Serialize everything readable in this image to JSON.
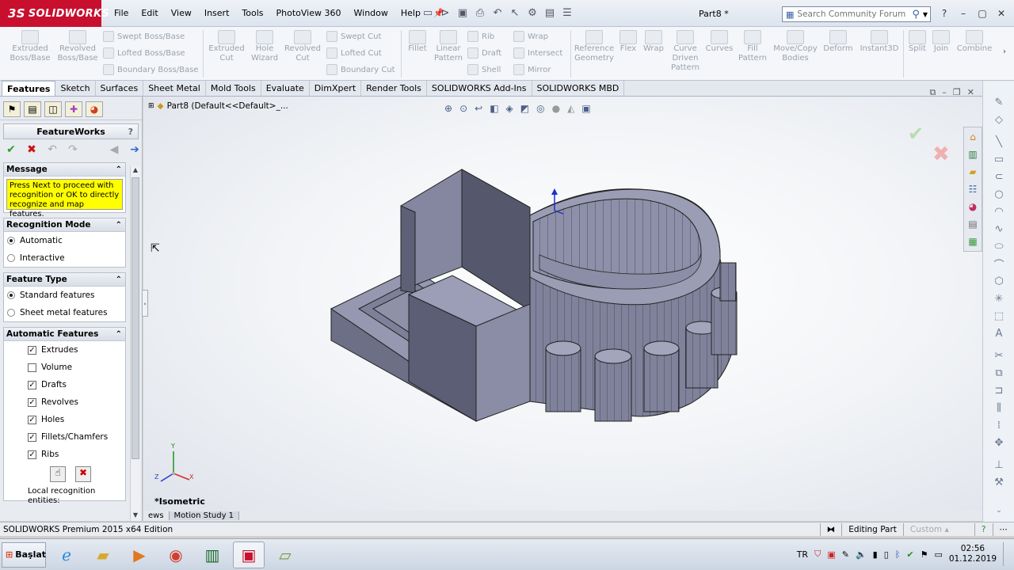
{
  "app": {
    "logo_text": "SOLIDWORKS",
    "logo_prefix": "3S",
    "document_title": "Part8 *",
    "colors": {
      "brand_red": "#c8102e",
      "message_yellow": "#ffff00",
      "ok_green": "#2ea02e",
      "cancel_red": "#cc1111"
    }
  },
  "menu": [
    "File",
    "Edit",
    "View",
    "Insert",
    "Tools",
    "PhotoView 360",
    "Window",
    "Help"
  ],
  "search": {
    "placeholder": "Search Community Forum"
  },
  "ribbon": {
    "extruded_boss": "Extruded Boss/Base",
    "revolved_boss": "Revolved Boss/Base",
    "swept_boss": "Swept Boss/Base",
    "lofted_boss": "Lofted Boss/Base",
    "boundary_boss": "Boundary Boss/Base",
    "extruded_cut": "Extruded Cut",
    "hole_wizard": "Hole Wizard",
    "revolved_cut": "Revolved Cut",
    "swept_cut": "Swept Cut",
    "lofted_cut": "Lofted Cut",
    "boundary_cut": "Boundary Cut",
    "fillet": "Fillet",
    "linear_pattern": "Linear Pattern",
    "rib": "Rib",
    "draft": "Draft",
    "shell": "Shell",
    "wrap": "Wrap",
    "intersect": "Intersect",
    "mirror": "Mirror",
    "reference_geometry": "Reference Geometry",
    "flex": "Flex",
    "wrap2": "Wrap",
    "curve_driven_pattern": "Curve Driven Pattern",
    "curves": "Curves",
    "fill_pattern": "Fill Pattern",
    "move_copy": "Move/Copy Bodies",
    "deform": "Deform",
    "instant3d": "Instant3D",
    "split": "Split",
    "join": "Join",
    "combine": "Combine"
  },
  "tabs": [
    "Features",
    "Sketch",
    "Surfaces",
    "Sheet Metal",
    "Mold Tools",
    "Evaluate",
    "DimXpert",
    "Render Tools",
    "SOLIDWORKS Add-Ins",
    "SOLIDWORKS MBD"
  ],
  "panel": {
    "title": "FeatureWorks",
    "help": "?",
    "message_title": "Message",
    "message_text": "Press Next to proceed with recognition or OK to directly recognize and map features.",
    "recognition_title": "Recognition Mode",
    "recognition_options": [
      {
        "label": "Automatic",
        "selected": true
      },
      {
        "label": "Interactive",
        "selected": false
      }
    ],
    "feature_type_title": "Feature Type",
    "feature_type_options": [
      {
        "label": "Standard features",
        "selected": true
      },
      {
        "label": "Sheet metal features",
        "selected": false
      }
    ],
    "auto_title": "Automatic Features",
    "auto_features": [
      {
        "label": "Extrudes",
        "checked": true
      },
      {
        "label": "Volume",
        "checked": false
      },
      {
        "label": "Drafts",
        "checked": true
      },
      {
        "label": "Revolves",
        "checked": true
      },
      {
        "label": "Holes",
        "checked": true
      },
      {
        "label": "Fillets/Chamfers",
        "checked": true
      },
      {
        "label": "Ribs",
        "checked": true
      }
    ],
    "local_recognition": "Local recognition entities:"
  },
  "viewport": {
    "tree_label": "Part8  (Default<<Default>_...",
    "view_name": "*Isometric",
    "axis_y": "Y",
    "axis_z": "Z",
    "axis_x": "X"
  },
  "bottom_tabs": [
    "ews",
    "Motion Study 1"
  ],
  "status": {
    "edition": "SOLIDWORKS Premium 2015 x64 Edition",
    "editing": "Editing Part",
    "custom": "Custom"
  },
  "taskbar": {
    "start": "Başlat",
    "lang": "TR",
    "time": "02:56",
    "date": "01.12.2019"
  }
}
